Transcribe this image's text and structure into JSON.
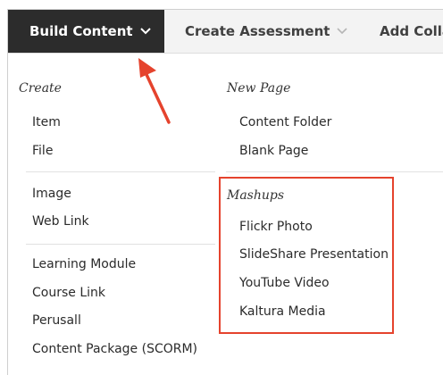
{
  "toolbar": {
    "build_content": "Build Content",
    "create_assessment": "Create Assessment",
    "add_colla": "Add Colla"
  },
  "menu": {
    "create_heading": "Create",
    "create_group1": [
      "Item",
      "File"
    ],
    "create_group2": [
      "Image",
      "Web Link"
    ],
    "create_group3": [
      "Learning Module",
      "Course Link",
      "Perusall",
      "Content Package (SCORM)"
    ],
    "new_page_heading": "New Page",
    "new_page_items": [
      "Content Folder",
      "Blank Page"
    ],
    "mashups_heading": "Mashups",
    "mashups_items": [
      "Flickr Photo",
      "SlideShare Presentation",
      "YouTube Video",
      "Kaltura Media"
    ]
  },
  "colors": {
    "active_tab": "#2c2c2c",
    "highlight": "#e5432d",
    "arrow": "#e5432d"
  },
  "icons": {
    "chevron": "chevron-down-icon",
    "arrow": "arrow-annotation-icon"
  }
}
